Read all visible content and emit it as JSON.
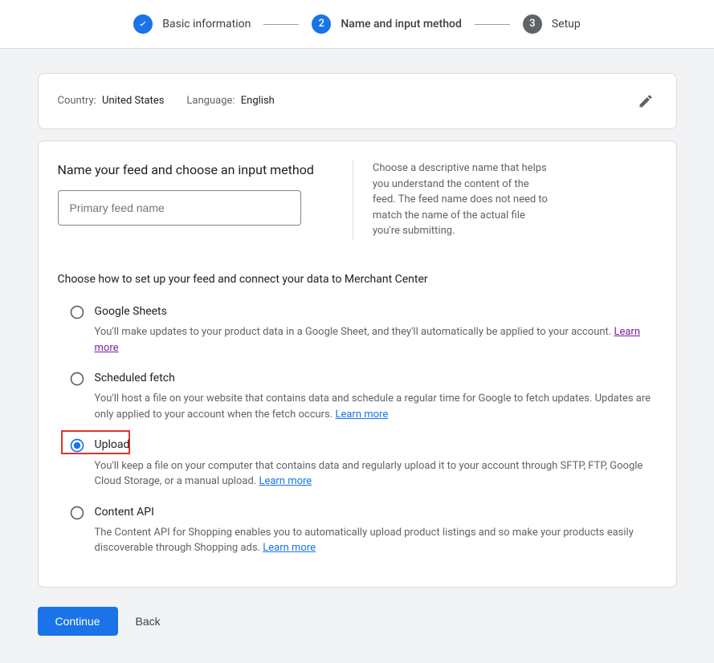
{
  "stepper": {
    "steps": [
      {
        "label": "Basic information"
      },
      {
        "label": "Name and input method",
        "number": "2"
      },
      {
        "label": "Setup",
        "number": "3"
      }
    ]
  },
  "summary": {
    "country_label": "Country:",
    "country_value": "United States",
    "language_label": "Language:",
    "language_value": "English"
  },
  "section_title": "Name your feed and choose an input method",
  "feed_name_placeholder": "Primary feed name",
  "help_text": "Choose a descriptive name that helps you understand the content of the feed. The feed name does not need to match the name of the actual file you're submitting.",
  "choose_title": "Choose how to set up your feed and connect your data to Merchant Center",
  "options": {
    "sheets": {
      "label": "Google Sheets",
      "desc": "You'll make updates to your product data in a Google Sheet, and they'll automatically be applied to your account.",
      "learn_more": "Learn more"
    },
    "fetch": {
      "label": "Scheduled fetch",
      "desc": "You'll host a file on your website that contains data and schedule a regular time for Google to fetch updates. Updates are only applied to your account when the fetch occurs.",
      "learn_more": "Learn more"
    },
    "upload": {
      "label": "Upload",
      "desc": "You'll keep a file on your computer that contains data and regularly upload it to your account through SFTP, FTP, Google Cloud Storage, or a manual upload.",
      "learn_more": "Learn more"
    },
    "api": {
      "label": "Content API",
      "desc": "The Content API for Shopping enables you to automatically upload product listings and so make your products easily discoverable through Shopping ads.",
      "learn_more": "Learn more"
    }
  },
  "buttons": {
    "continue": "Continue",
    "back": "Back"
  }
}
